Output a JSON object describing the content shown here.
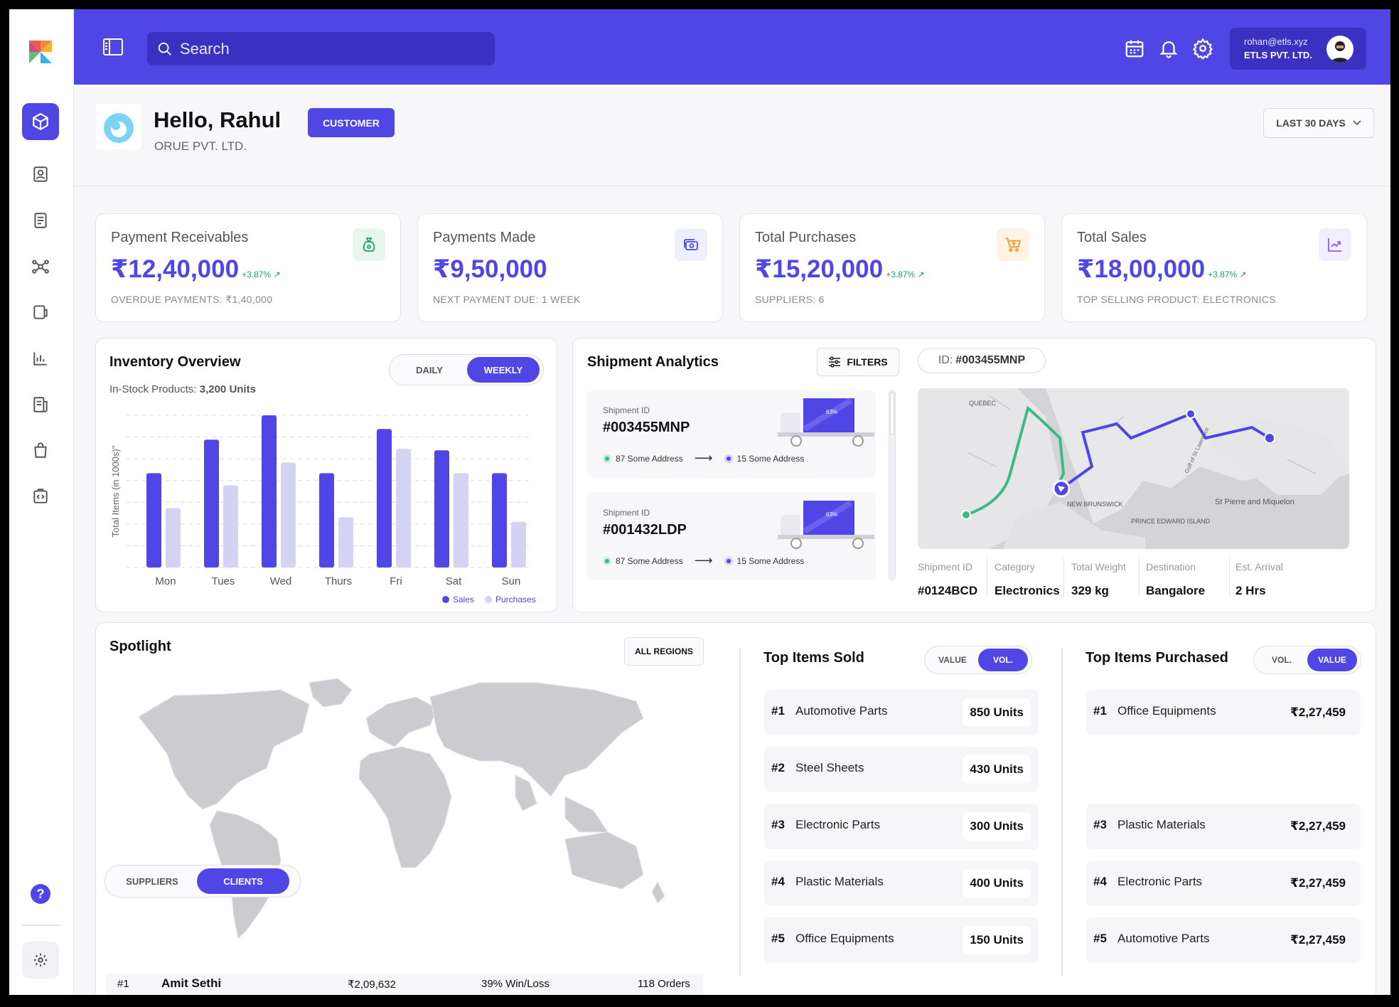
{
  "header": {
    "search_placeholder": "Search",
    "account_email": "rohan@etls.xyz",
    "account_org": "ETLS PVT. LTD."
  },
  "greeting": {
    "title": "Hello, Rahul",
    "company": "ORUE PVT. LTD.",
    "badge": "CUSTOMER",
    "range": "LAST 30 DAYS"
  },
  "stats": [
    {
      "title": "Payment Receivables",
      "value": "₹12,40,000",
      "change": "+3.87%",
      "footer": "OVERDUE PAYMENTS: ₹1,40,000",
      "icon": "money-bag-icon",
      "icon_bg": "#e7f7ee",
      "icon_color": "#22a06b"
    },
    {
      "title": "Payments Made",
      "value": "₹9,50,000",
      "change": "",
      "footer": "NEXT PAYMENT DUE: 1 WEEK",
      "icon": "cash-icon",
      "icon_bg": "#eef0ff",
      "icon_color": "#4f46e5"
    },
    {
      "title": "Total Purchases",
      "value": "₹15,20,000",
      "change": "+3.87%",
      "footer": "SUPPLIERS: 6",
      "icon": "cart-icon",
      "icon_bg": "#fff3e4",
      "icon_color": "#f29a2e"
    },
    {
      "title": "Total Sales",
      "value": "₹18,00,000",
      "change": "+3.87%",
      "footer": "TOP SELLING PRODUCT: ELECTRONICS",
      "icon": "trend-icon",
      "icon_bg": "#f3eefe",
      "icon_color": "#8b5cf6"
    }
  ],
  "inventory": {
    "title": "Inventory Overview",
    "subtitle_label": "In-Stock Products:",
    "subtitle_value": "3,200 Units",
    "toggle": [
      "DAILY",
      "WEEKLY"
    ],
    "active_toggle": "WEEKLY"
  },
  "chart_data": {
    "type": "bar",
    "categories": [
      "Mon",
      "Tues",
      "Wed",
      "Thurs",
      "Fri",
      "Sat",
      "Sun"
    ],
    "series": [
      {
        "name": "Sales",
        "values": [
          6.2,
          8.4,
          10,
          6.2,
          9.1,
          7.7,
          6.2
        ],
        "color": "#4f46e5"
      },
      {
        "name": "Purchases",
        "values": [
          3.9,
          5.4,
          6.9,
          3.3,
          7.8,
          6.2,
          3.0
        ],
        "color": "#d5d3f3"
      }
    ],
    "ylabel": "Total Items (in 1000s)\"",
    "ylim": [
      0,
      10
    ],
    "grid": true,
    "legend": "bottom-right"
  },
  "shipment": {
    "title": "Shipment Analytics",
    "filters_label": "FILTERS",
    "id_label": "ID:",
    "id_value": "#003455MNP",
    "cards": [
      {
        "label": "Shipment ID",
        "id": "#003455MNP",
        "from": "87 Some Address",
        "to": "15 Some Address",
        "progress": "63%"
      },
      {
        "label": "Shipment ID",
        "id": "#001432LDP",
        "from": "87 Some Address",
        "to": "15 Some Address",
        "progress": "63%"
      }
    ],
    "map_labels": [
      "QUEBEC",
      "NEW BRUNSWICK",
      "PRINCE EDWARD ISLAND",
      "St Pierre and Miquelon",
      "Gulf of St Lawrence"
    ],
    "details": [
      {
        "label": "Shipment ID",
        "value": "#0124BCD"
      },
      {
        "label": "Category",
        "value": "Electronics"
      },
      {
        "label": "Total Weight",
        "value": "329 kg"
      },
      {
        "label": "Destination",
        "value": "Bangalore"
      },
      {
        "label": "Est. Arrival",
        "value": "2 Hrs"
      }
    ]
  },
  "spotlight": {
    "title": "Spotlight",
    "regions_label": "ALL REGIONS",
    "tabs": [
      "SUPPLIERS",
      "CLIENTS"
    ],
    "active_tab": "CLIENTS",
    "rows": [
      {
        "rank": "#1",
        "name": "Amit Sethi",
        "amount": "₹2,09,632",
        "winloss": "39% Win/Loss",
        "orders": "118 Orders"
      }
    ]
  },
  "top_sold": {
    "title": "Top Items Sold",
    "toggle": [
      "VALUE",
      "VOL."
    ],
    "active": "VOL.",
    "items": [
      {
        "rank": "#1",
        "name": "Automotive Parts",
        "value": "850 Units"
      },
      {
        "rank": "#2",
        "name": "Steel Sheets",
        "value": "430 Units"
      },
      {
        "rank": "#3",
        "name": "Electronic Parts",
        "value": "300 Units"
      },
      {
        "rank": "#4",
        "name": "Plastic Materials",
        "value": "400 Units"
      },
      {
        "rank": "#5",
        "name": "Office Equipments",
        "value": "150 Units"
      }
    ]
  },
  "top_purchased": {
    "title": "Top Items Purchased",
    "toggle": [
      "VOL.",
      "VALUE"
    ],
    "active": "VALUE",
    "items": [
      {
        "rank": "#1",
        "name": "Office Equipments",
        "value": "₹2,27,459"
      },
      {
        "rank": "#3",
        "name": "Plastic Materials",
        "value": "₹2,27,459"
      },
      {
        "rank": "#4",
        "name": "Electronic Parts",
        "value": "₹2,27,459"
      },
      {
        "rank": "#5",
        "name": "Automotive Parts",
        "value": "₹2,27,459"
      }
    ]
  }
}
